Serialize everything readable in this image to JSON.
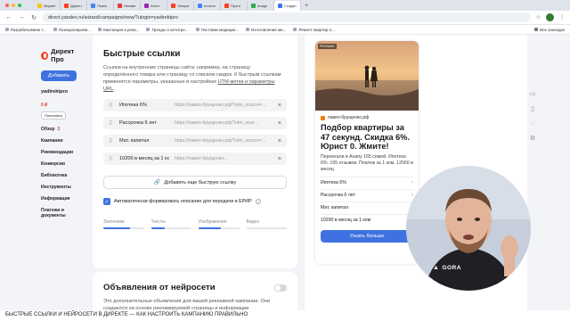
{
  "browser": {
    "tabs": [
      {
        "label": "Маркет",
        "color": "#f5c518",
        "active": false
      },
      {
        "label": "Директ",
        "color": "#fc3f1d",
        "active": false
      },
      {
        "label": "Поиск",
        "color": "#4285f4",
        "active": false
      },
      {
        "label": "Неизве",
        "color": "#e53935",
        "active": false
      },
      {
        "label": "Агент",
        "color": "#9c27b0",
        "active": false
      },
      {
        "label": "Генера",
        "color": "#fc3f1d",
        "active": false
      },
      {
        "label": "потоло",
        "color": "#4285f4",
        "active": false
      },
      {
        "label": "Прогн",
        "color": "#fc3f1d",
        "active": false
      },
      {
        "label": "Image",
        "color": "#34a853",
        "active": false
      },
      {
        "label": "Создан",
        "color": "#3f72e0",
        "active": true
      }
    ],
    "url": "direct.yandex.ru/wizard/campaigns/new/?ulogin=yadirektpro",
    "bookmarks": [
      "Разрабатываем т...",
      "Позиционирова...",
      "Квитанция в река...",
      "Тренды и антитре...",
      "Поставки медицин...",
      "Изготовление ме...",
      "Ремонт квартир п..."
    ],
    "all_bookmarks": "Все закладки"
  },
  "sidebar": {
    "logo": "Директ Про",
    "add_button": "Добавить",
    "login": "yadirektpro",
    "balance": "0 ₽",
    "topup_button": "Пополнить",
    "menu": [
      {
        "label": "Обзор",
        "count": "3"
      },
      {
        "label": "Кампании",
        "count": ""
      },
      {
        "label": "Рекомендации",
        "count": ""
      },
      {
        "label": "Конверсии",
        "count": ""
      },
      {
        "label": "Библиотека",
        "count": ""
      },
      {
        "label": "Инструменты",
        "count": ""
      },
      {
        "label": "Информация",
        "count": ""
      },
      {
        "label": "Платежи и документы",
        "count": ""
      }
    ]
  },
  "quick_links": {
    "title": "Быстрые ссылки",
    "description_before": "Ссылки на внутренние страницы сайта: например, на страницу определённого товара или страницу со списком скидок. К быстрым ссылкам применятся параметры, указанные в настройках ",
    "description_link": "UTM-метки и параметры URL",
    "description_after": ".",
    "items": [
      {
        "title": "Ипотека 6%",
        "url": "https://павел-брущенко.рф/?utm_source=..."
      },
      {
        "title": "Рассрочка 6 лет",
        "url": "https://павел-брущенко.рф/?utm_sour..."
      },
      {
        "title": "Мат. капитал",
        "url": "https://павел-брущенко.рф/?utm_source=..."
      },
      {
        "title": "10200 в месяц за 1 ком",
        "url": "https://павел-брущенко..."
      }
    ],
    "add_button": "Добавить еще быструю ссылку",
    "auto_describe": "Автоматически формировать описание для передачи в ЕРИР"
  },
  "progress": [
    {
      "label": "Заголовки",
      "fill": 0.65
    },
    {
      "label": "Тексты",
      "fill": 0.35
    },
    {
      "label": "Изображения",
      "fill": 0.55
    },
    {
      "label": "Видео",
      "fill": 0.0
    }
  ],
  "neuro": {
    "title": "Объявления от нейросети",
    "description": "Это дополнительные объявления для вашей рекламной кампании. Они создаются на основе рекламируемой страницы и информации"
  },
  "ad_preview": {
    "badge": "РЕКЛАМА",
    "domain": "павел-брущенко.рф",
    "title": "Подбор квартиры за 47 секунд. Скидка 6%. Юрист 0. Жмите!",
    "text": "Переехали в Анапу 165 семей. Ипотека 6%. 195 отзывов. Платеж за 1 ком. 12560 в месяц",
    "links": [
      "Ипотека 6%",
      "Рассрочка 6 лет",
      "Мат. капитал",
      "10200 в месяц за 1 ком"
    ],
    "cta": "Узнать больше"
  },
  "watermark": "GORA",
  "caption": "БЫСТРЫЕ ССЫЛКИ И НЕЙРОСЕТИ В ДИРЕКТЕ — КАК НАСТРОИТЬ КАМПАНИЮ ПРАВИЛЬНО"
}
